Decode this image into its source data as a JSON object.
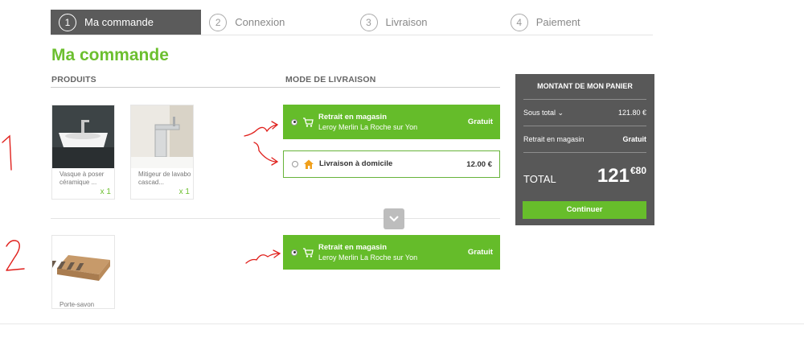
{
  "stepper": {
    "steps": [
      {
        "number": "1",
        "label": "Ma commande",
        "active": true
      },
      {
        "number": "2",
        "label": "Connexion",
        "active": false
      },
      {
        "number": "3",
        "label": "Livraison",
        "active": false
      },
      {
        "number": "4",
        "label": "Paiement",
        "active": false
      }
    ]
  },
  "page": {
    "title": "Ma commande",
    "products_header": "PRODUITS",
    "delivery_header": "MODE DE LIVRAISON"
  },
  "groups": [
    {
      "products": [
        {
          "name": "Vasque à poser céramique ...",
          "qty": "x 1"
        },
        {
          "name": "Mitigeur de lavabo cascad...",
          "qty": "x 1"
        }
      ],
      "options": [
        {
          "title": "Retrait en magasin",
          "subtitle": "Leroy Merlin La Roche sur Yon",
          "price": "Gratuit",
          "selected": true,
          "icon": "store-cart-icon"
        },
        {
          "title": "Livraison à domicile",
          "subtitle": "",
          "price": "12.00 €",
          "selected": false,
          "icon": "home-icon"
        }
      ]
    },
    {
      "products": [
        {
          "name": "Porte-savon",
          "qty": ""
        }
      ],
      "options": [
        {
          "title": "Retrait en magasin",
          "subtitle": "Leroy Merlin La Roche sur Yon",
          "price": "Gratuit",
          "selected": true,
          "icon": "store-cart-icon"
        }
      ]
    }
  ],
  "cart": {
    "title": "MONTANT DE MON PANIER",
    "subtotal_label": "Sous total ⌄",
    "subtotal_value": "121.80 €",
    "pickup_label": "Retrait en magasin",
    "pickup_value": "Gratuit",
    "total_label": "TOTAL",
    "total_main": "121",
    "total_cents": "€80",
    "continue_label": "Continuer"
  },
  "annotations": {
    "numbers": [
      "1",
      "2"
    ],
    "color": "#e0201c"
  },
  "colors": {
    "accent_green": "#65bc2a",
    "panel_gray": "#585858"
  }
}
